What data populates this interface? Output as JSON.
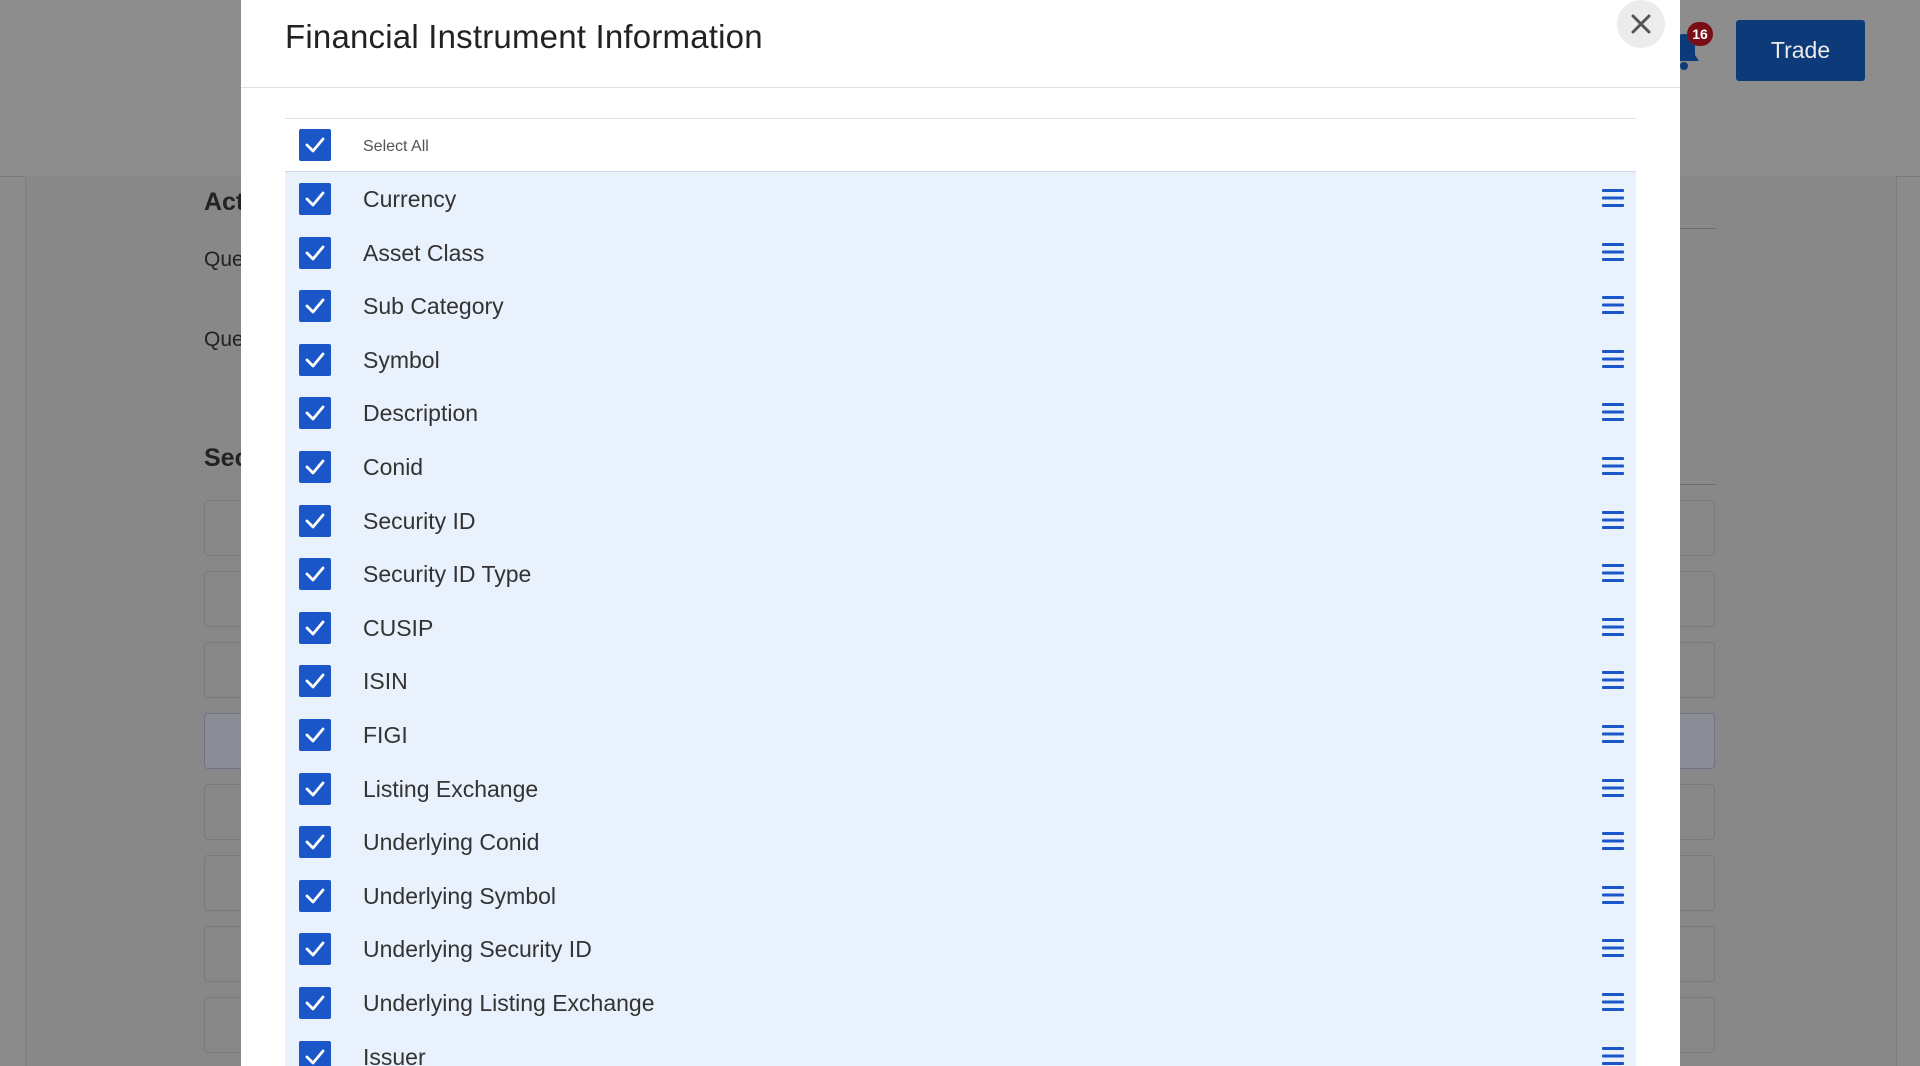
{
  "header": {
    "notification_count": "16",
    "trade_label": "Trade"
  },
  "background": {
    "section1_heading": "Act",
    "label1": "Que",
    "label2": "Que",
    "section2_heading": "Sec"
  },
  "modal": {
    "title": "Financial Instrument Information",
    "select_all_label": "Select All",
    "items": [
      {
        "label": "Currency",
        "checked": true
      },
      {
        "label": "Asset Class",
        "checked": true
      },
      {
        "label": "Sub Category",
        "checked": true
      },
      {
        "label": "Symbol",
        "checked": true
      },
      {
        "label": "Description",
        "checked": true
      },
      {
        "label": "Conid",
        "checked": true
      },
      {
        "label": "Security ID",
        "checked": true
      },
      {
        "label": "Security ID Type",
        "checked": true
      },
      {
        "label": "CUSIP",
        "checked": true
      },
      {
        "label": "ISIN",
        "checked": true
      },
      {
        "label": "FIGI",
        "checked": true
      },
      {
        "label": "Listing Exchange",
        "checked": true
      },
      {
        "label": "Underlying Conid",
        "checked": true
      },
      {
        "label": "Underlying Symbol",
        "checked": true
      },
      {
        "label": "Underlying Security ID",
        "checked": true
      },
      {
        "label": "Underlying Listing Exchange",
        "checked": true
      },
      {
        "label": "Issuer",
        "checked": true
      }
    ]
  },
  "colors": {
    "accent": "#1a56c7",
    "row_background": "#e9f1fc",
    "trade_button": "#0d3a78",
    "badge": "#7a0e16"
  }
}
